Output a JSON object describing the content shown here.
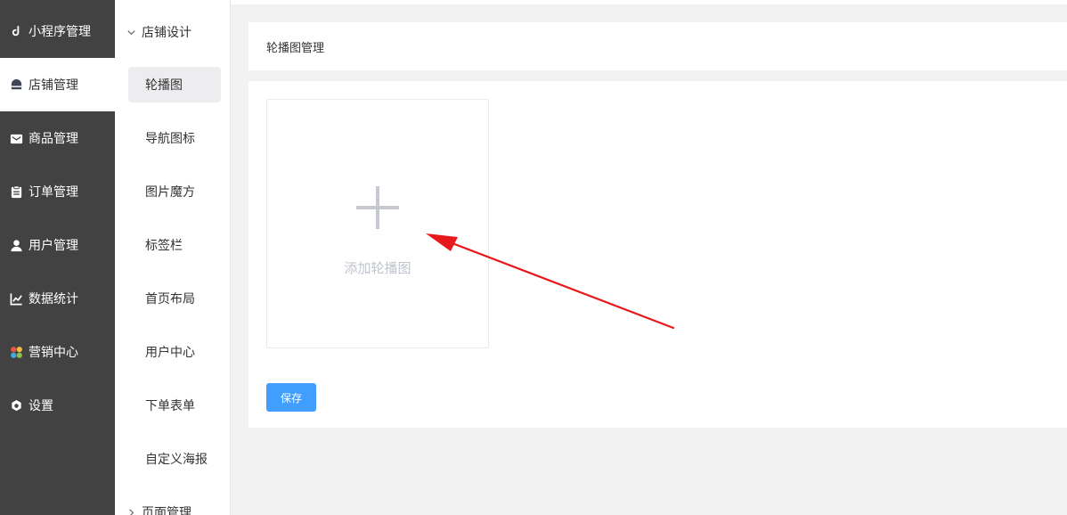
{
  "sidebar": {
    "items": [
      {
        "label": "小程序管理",
        "icon": "link-icon"
      },
      {
        "label": "店铺管理",
        "icon": "shop-icon"
      },
      {
        "label": "商品管理",
        "icon": "envelope-icon"
      },
      {
        "label": "订单管理",
        "icon": "clipboard-icon"
      },
      {
        "label": "用户管理",
        "icon": "user-icon"
      },
      {
        "label": "数据统计",
        "icon": "line-chart-icon"
      },
      {
        "label": "营销中心",
        "icon": "marketing-icon"
      },
      {
        "label": "设置",
        "icon": "gear-icon"
      }
    ],
    "active_index": 1
  },
  "submenu": {
    "group_open": "店铺设计",
    "items": [
      "轮播图",
      "导航图标",
      "图片魔方",
      "标签栏",
      "首页布局",
      "用户中心",
      "下单表单",
      "自定义海报"
    ],
    "active_index": 0,
    "group_collapsed": "页面管理"
  },
  "main": {
    "page_title": "轮播图管理",
    "upload_label": "添加轮播图",
    "save_label": "保存"
  },
  "colors": {
    "sidebar_bg": "#424242",
    "primary": "#409eff",
    "annotation_arrow": "#e8191c"
  }
}
